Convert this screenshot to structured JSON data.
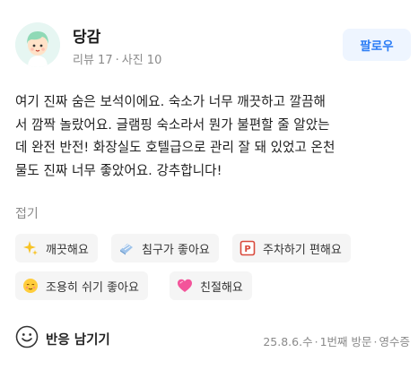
{
  "user": {
    "name": "당감",
    "reviews_label": "리뷰 17",
    "photos_label": "사진 10",
    "follow_label": "팔로우"
  },
  "review": {
    "lines": [
      "여기 진짜 숨은 보석이에요. 숙소가 너무 깨끗하고 깔끔해",
      "서 깜짝 놀랐어요. 글램핑 숙소라서 뭔가 불편할 줄 알았는",
      "데 완전 반전! 화장실도 호텔급으로 관리 잘 돼 있었고 온천",
      "물도 진짜 너무 좋았어요. 강추합니다!"
    ],
    "fold_label": "접기"
  },
  "tags": [
    {
      "label": "깨끗해요",
      "icon": "sparkles-icon"
    },
    {
      "label": "침구가 좋아요",
      "icon": "bedding-icon"
    },
    {
      "label": "주차하기 편해요",
      "icon": "parking-icon"
    },
    {
      "label": "조용히 쉬기 좋아요",
      "icon": "relieved-face-icon"
    },
    {
      "label": "친절해요",
      "icon": "heart-icon"
    }
  ],
  "footer": {
    "react_label": "반응 남기기",
    "date": "25.8.6.수",
    "visit_count": "1번째 방문",
    "receipt": "영수증"
  },
  "colors": {
    "accent": "#2a7cf5",
    "follow_bg": "#eef5ff",
    "tag_bg": "#f5f5f5",
    "muted_text": "#8a8a8a"
  }
}
